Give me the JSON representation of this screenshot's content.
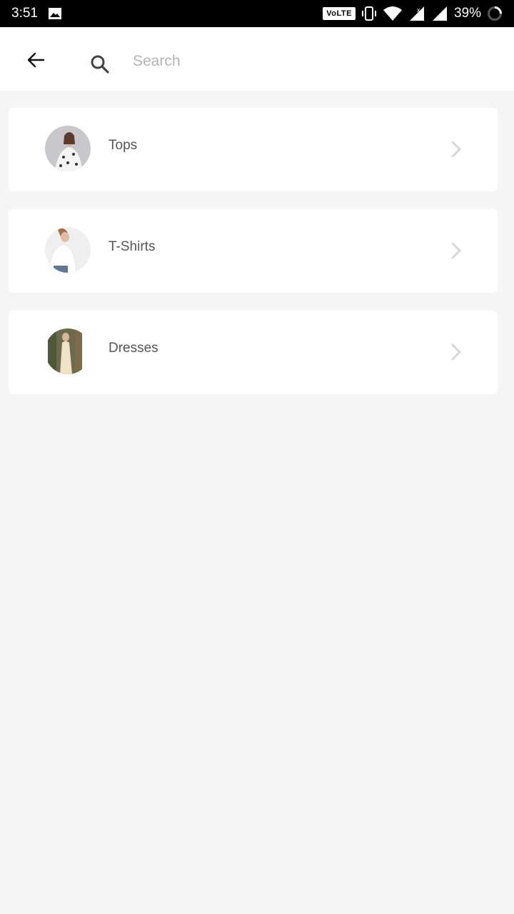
{
  "status_bar": {
    "time": "3:51",
    "network_badge": "VoLTE",
    "battery": "39%",
    "icons": [
      "image-icon",
      "vibrate-icon",
      "wifi-icon",
      "signal-icon",
      "signal-icon",
      "battery-icon"
    ]
  },
  "header": {
    "back_icon": "arrow-left-icon",
    "search_icon": "search-icon",
    "search_placeholder": "Search",
    "search_value": ""
  },
  "categories": [
    {
      "label": "Tops",
      "thumb": "tops-thumbnail"
    },
    {
      "label": "T-Shirts",
      "thumb": "tshirts-thumbnail"
    },
    {
      "label": "Dresses",
      "thumb": "dresses-thumbnail"
    }
  ],
  "colors": {
    "background": "#f5f5f5",
    "card": "#ffffff",
    "label": "#555555",
    "placeholder": "#b4b4b4",
    "chevron": "#d6d6d6"
  }
}
